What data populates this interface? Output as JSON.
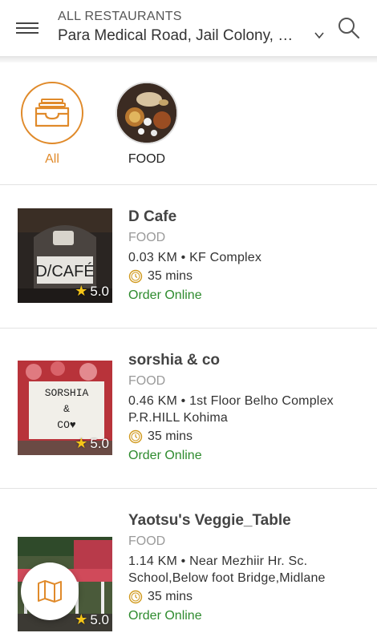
{
  "header": {
    "location_label": "ALL RESTAURANTS",
    "location_value": "Para Medical Road, Jail Colony, …",
    "icons": {
      "menu": "hamburger-menu-icon",
      "chevron": "chevron-down-icon",
      "search": "search-icon"
    }
  },
  "categories": [
    {
      "label": "All",
      "icon": "box-tray-icon",
      "selected": true
    },
    {
      "label": "FOOD",
      "icon": "food-photo",
      "selected": false
    }
  ],
  "restaurants": [
    {
      "name": "D Cafe",
      "category": "FOOD",
      "address_line1": "0.03 KM • KF Complex",
      "address_line2": "",
      "time": "35 mins",
      "order": "Order Online",
      "rating": "5.0",
      "thumb_text": "D/CAFÉ"
    },
    {
      "name": "sorshia & co",
      "category": "FOOD",
      "address_line1": "0.46 KM • 1st Floor Belho Complex",
      "address_line2": "P.R.HILL Kohima",
      "time": "35 mins",
      "order": "Order Online",
      "rating": "5.0",
      "thumb_text_1": "SORSHIA",
      "thumb_text_2": "&",
      "thumb_text_3": "CO♥"
    },
    {
      "name": "Yaotsu's Veggie_Table",
      "category": "FOOD",
      "address_line1": "1.14 KM • Near Mezhiir Hr. Sc.",
      "address_line2": "School,Below foot Bridge,Midlane",
      "time": "35 mins",
      "order": "Order Online",
      "rating": "5.0"
    }
  ],
  "fab": {
    "icon": "map-icon"
  },
  "colors": {
    "accent": "#e08a2a",
    "order_green": "#2e8b2e",
    "star": "#f5c518"
  }
}
